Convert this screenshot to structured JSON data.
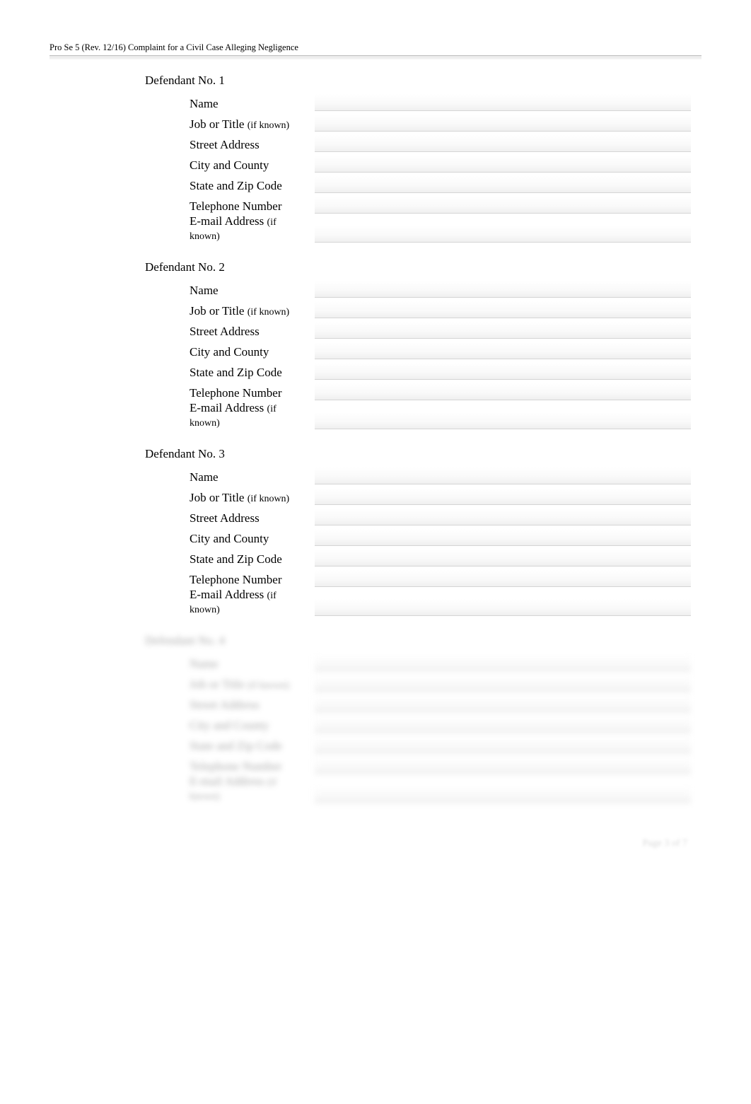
{
  "header": {
    "form_info": "Pro Se 5 (Rev. 12/16) Complaint for a Civil Case Alleging Negligence"
  },
  "defendants": [
    {
      "title": "Defendant No. 1",
      "fields": {
        "name_label": "Name",
        "job_label": "Job or Title",
        "job_suffix": "(if known)",
        "street_label": "Street Address",
        "city_label": "City and County",
        "state_label": "State and Zip Code",
        "phone_label": "Telephone Number",
        "email_label": "E-mail Address",
        "email_suffix": "(if known)"
      }
    },
    {
      "title": "Defendant No. 2",
      "fields": {
        "name_label": "Name",
        "job_label": "Job or Title",
        "job_suffix": "(if known)",
        "street_label": "Street Address",
        "city_label": "City and County",
        "state_label": "State and Zip Code",
        "phone_label": "Telephone Number",
        "email_label": "E-mail Address",
        "email_suffix": "(if known)"
      }
    },
    {
      "title": "Defendant No. 3",
      "fields": {
        "name_label": "Name",
        "job_label": "Job or Title",
        "job_suffix": "(if known)",
        "street_label": "Street Address",
        "city_label": "City and County",
        "state_label": "State and Zip Code",
        "phone_label": "Telephone Number",
        "email_label": "E-mail Address",
        "email_suffix": "(if known)"
      }
    },
    {
      "title": "Defendant No. 4",
      "fields": {
        "name_label": "Name",
        "job_label": "Job or Title",
        "job_suffix": "(if known)",
        "street_label": "Street Address",
        "city_label": "City and County",
        "state_label": "State and Zip Code",
        "phone_label": "Telephone Number",
        "email_label": "E-mail Address",
        "email_suffix": "(if known)"
      }
    }
  ],
  "footer": {
    "page_label": "Page 3 of 7"
  }
}
